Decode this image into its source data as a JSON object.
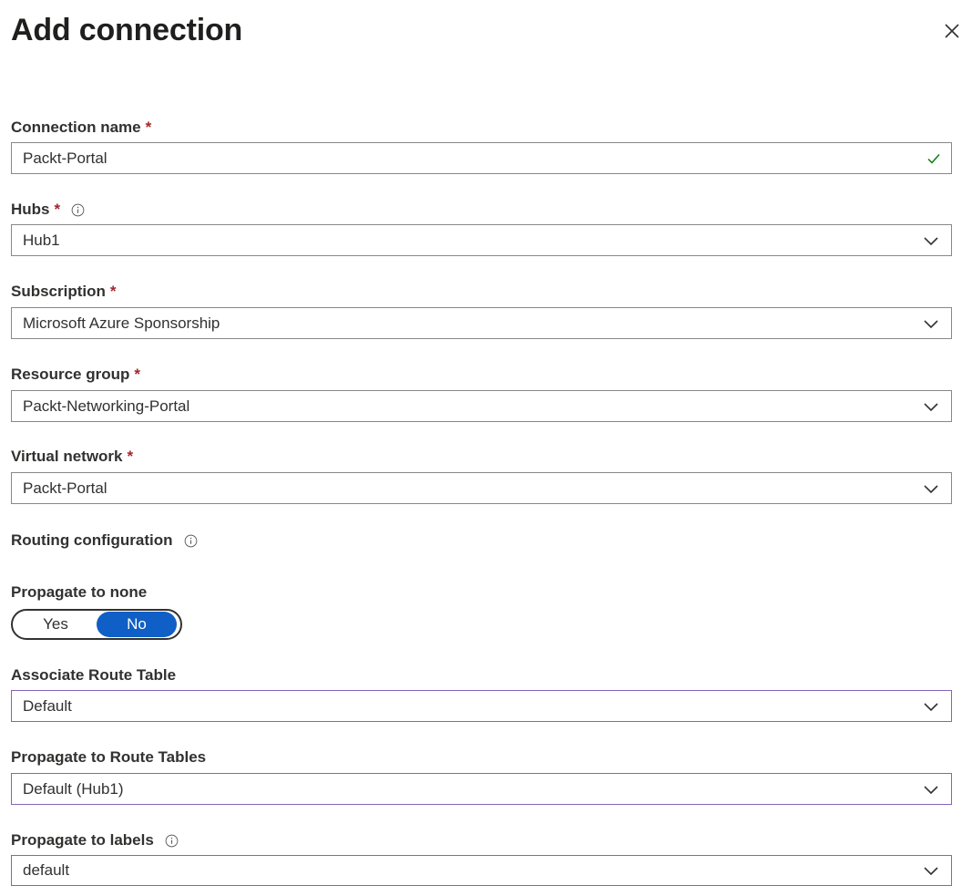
{
  "header": {
    "title": "Add connection",
    "close_icon": "close-icon"
  },
  "colors": {
    "required": "#a4262c",
    "toggle_on": "#0f5fc6",
    "focus_border": "#8764b8",
    "valid_check": "#107c10"
  },
  "fields": {
    "connection_name": {
      "label": "Connection name",
      "required_mark": "*",
      "value": "Packt-Portal",
      "status_icon": "checkmark-icon"
    },
    "hubs": {
      "label": "Hubs",
      "required_mark": "*",
      "value": "Hub1"
    },
    "subscription": {
      "label": "Subscription",
      "required_mark": "*",
      "value": "Microsoft Azure Sponsorship"
    },
    "resource_group": {
      "label": "Resource group",
      "required_mark": "*",
      "value": "Packt-Networking-Portal"
    },
    "virtual_network": {
      "label": "Virtual network",
      "required_mark": "*",
      "value": "Packt-Portal"
    }
  },
  "routing": {
    "section_label": "Routing configuration",
    "propagate_to_none": {
      "label": "Propagate to none",
      "options": [
        "Yes",
        "No"
      ],
      "selected": "No"
    },
    "associate_route_table": {
      "label": "Associate Route Table",
      "value": "Default"
    },
    "propagate_to_route_tables": {
      "label": "Propagate to Route Tables",
      "value": "Default (Hub1)"
    },
    "propagate_to_labels": {
      "label": "Propagate to labels",
      "value": "default"
    }
  }
}
